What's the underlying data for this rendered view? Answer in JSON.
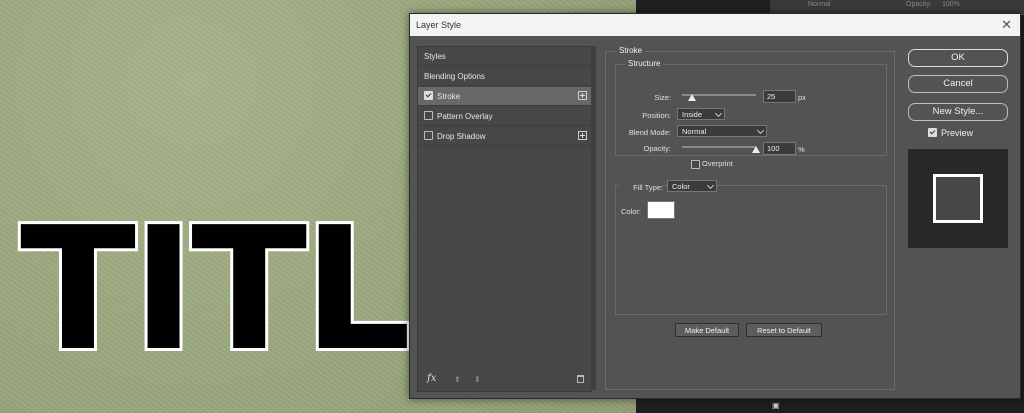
{
  "dialog": {
    "title": "Layer Style",
    "close_glyph": "✕"
  },
  "canvas": {
    "text": "TITLE"
  },
  "right_panel": {
    "blend_mode": "Normal",
    "opacity_label": "Opacity:",
    "opacity_value": "100%"
  },
  "styles_list": {
    "items": [
      {
        "label": "Styles",
        "checkbox": false,
        "checked": false,
        "plus": false
      },
      {
        "label": "Blending Options",
        "checkbox": false,
        "checked": false,
        "plus": false
      },
      {
        "label": "Stroke",
        "checkbox": true,
        "checked": true,
        "plus": true
      },
      {
        "label": "Pattern Overlay",
        "checkbox": true,
        "checked": false,
        "plus": false
      },
      {
        "label": "Drop Shadow",
        "checkbox": true,
        "checked": false,
        "plus": true
      }
    ],
    "fx_label": "fx",
    "up_glyph": "⬆",
    "down_glyph": "⬇"
  },
  "stroke": {
    "section_title": "Stroke",
    "structure": {
      "title": "Structure",
      "size_label": "Size:",
      "size_value": "25",
      "size_unit": "px",
      "size_slider_fraction": 0.13,
      "position_label": "Position:",
      "position_value": "Inside",
      "blend_mode_label": "Blend Mode:",
      "blend_mode_value": "Normal",
      "opacity_label": "Opacity:",
      "opacity_value": "100",
      "opacity_unit": "%",
      "opacity_slider_fraction": 1.0,
      "overprint_label": "Overprint"
    },
    "fill": {
      "fill_type_label": "Fill Type:",
      "fill_type_value": "Color",
      "color_label": "Color:",
      "color_hex": "#ffffff"
    },
    "make_default_label": "Make Default",
    "reset_default_label": "Reset to Default"
  },
  "actions": {
    "ok_label": "OK",
    "cancel_label": "Cancel",
    "new_style_label": "New Style...",
    "preview_label": "Preview",
    "preview_checked": true
  }
}
